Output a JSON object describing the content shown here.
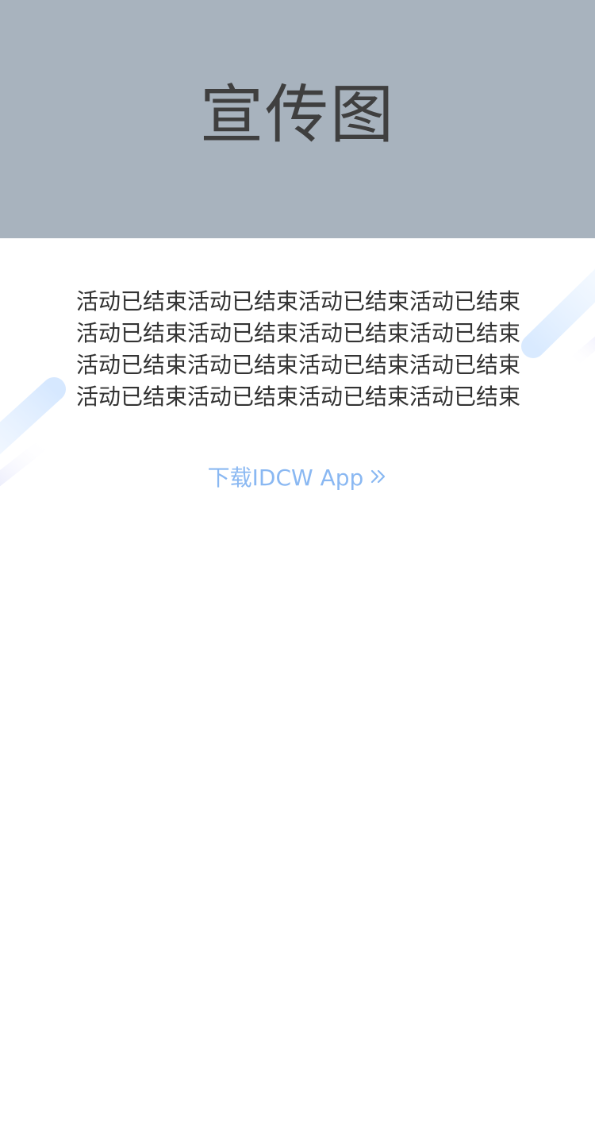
{
  "banner": {
    "title": "宣传图"
  },
  "content": {
    "message": "活动已结束活动已结束活动已结束活动已结束活动已结束活动已结束活动已结束活动已结束活动已结束活动已结束活动已结束活动已结束活动已结束活动已结束活动已结束活动已结束"
  },
  "download": {
    "label": "下载IDCW App",
    "icon": "double-chevron-right-icon"
  },
  "colors": {
    "banner_bg": "#a8b3be",
    "title_text": "#3f3f3f",
    "body_text": "#333333",
    "link": "#8ab8f2",
    "decor_stripe": "#d9eaff"
  }
}
